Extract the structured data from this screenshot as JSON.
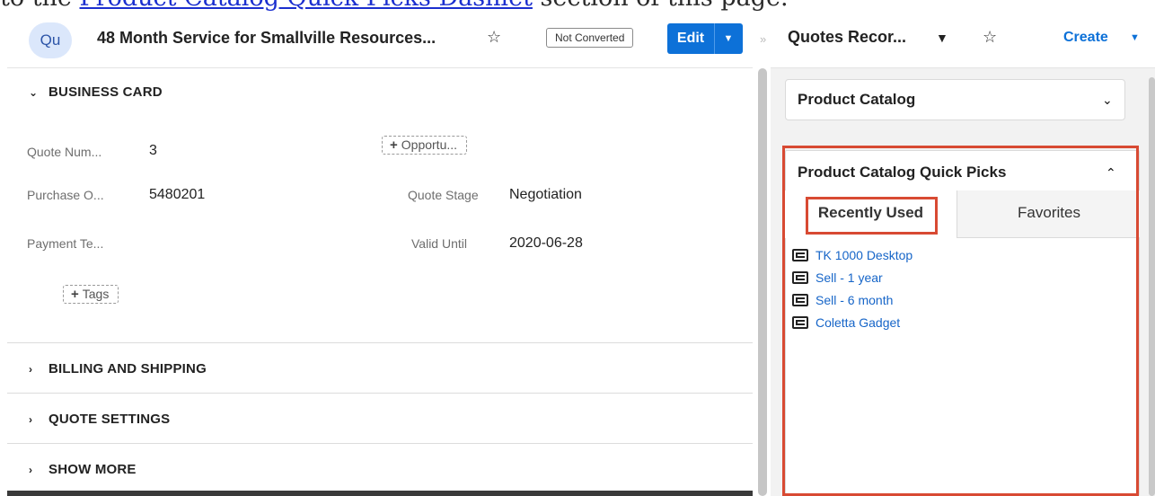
{
  "doc_strip": {
    "before": "to the ",
    "link": "Product Catalog Quick Picks Dashlet",
    "after": " section of this page."
  },
  "record": {
    "avatar": "Qu",
    "title": "48 Month Service for Smallville Resources...",
    "status_badge": "Not Converted",
    "edit_label": "Edit"
  },
  "business_card": {
    "heading": "BUSINESS CARD",
    "fields": {
      "quote_number": {
        "label": "Quote Num...",
        "value": "3"
      },
      "opportunity_pill": "Opportu...",
      "purchase_order": {
        "label": "Purchase O...",
        "value": "5480201"
      },
      "quote_stage": {
        "label": "Quote Stage",
        "value": "Negotiation"
      },
      "payment_terms": {
        "label": "Payment Te...",
        "value": ""
      },
      "valid_until": {
        "label": "Valid Until",
        "value": "2020-06-28"
      }
    },
    "tags_pill": "Tags"
  },
  "panels": [
    {
      "heading": "BILLING AND SHIPPING"
    },
    {
      "heading": "QUOTE SETTINGS"
    },
    {
      "heading": "SHOW MORE"
    }
  ],
  "right_pane": {
    "title": "Quotes Recor...",
    "create_label": "Create",
    "product_catalog": {
      "title": "Product Catalog"
    },
    "quick_picks": {
      "title": "Product Catalog Quick Picks",
      "tabs": [
        {
          "label": "Recently Used",
          "active": true
        },
        {
          "label": "Favorites",
          "active": false
        }
      ],
      "items": [
        {
          "label": "TK 1000 Desktop"
        },
        {
          "label": "Sell - 1 year"
        },
        {
          "label": "Sell - 6 month"
        },
        {
          "label": "Coletta Gadget"
        }
      ]
    }
  },
  "colors": {
    "primary_button": "#0d71d8",
    "link": "#1665c8",
    "highlight_annotation": "#d84a33",
    "avatar_bg": "#dbe7fb"
  },
  "icons": [
    "star-icon",
    "chevron-down-icon",
    "chevron-right-icon",
    "chevron-up-icon",
    "caret-down-icon",
    "plus-icon",
    "product-list-icon",
    "collapse-arrows-icon"
  ]
}
